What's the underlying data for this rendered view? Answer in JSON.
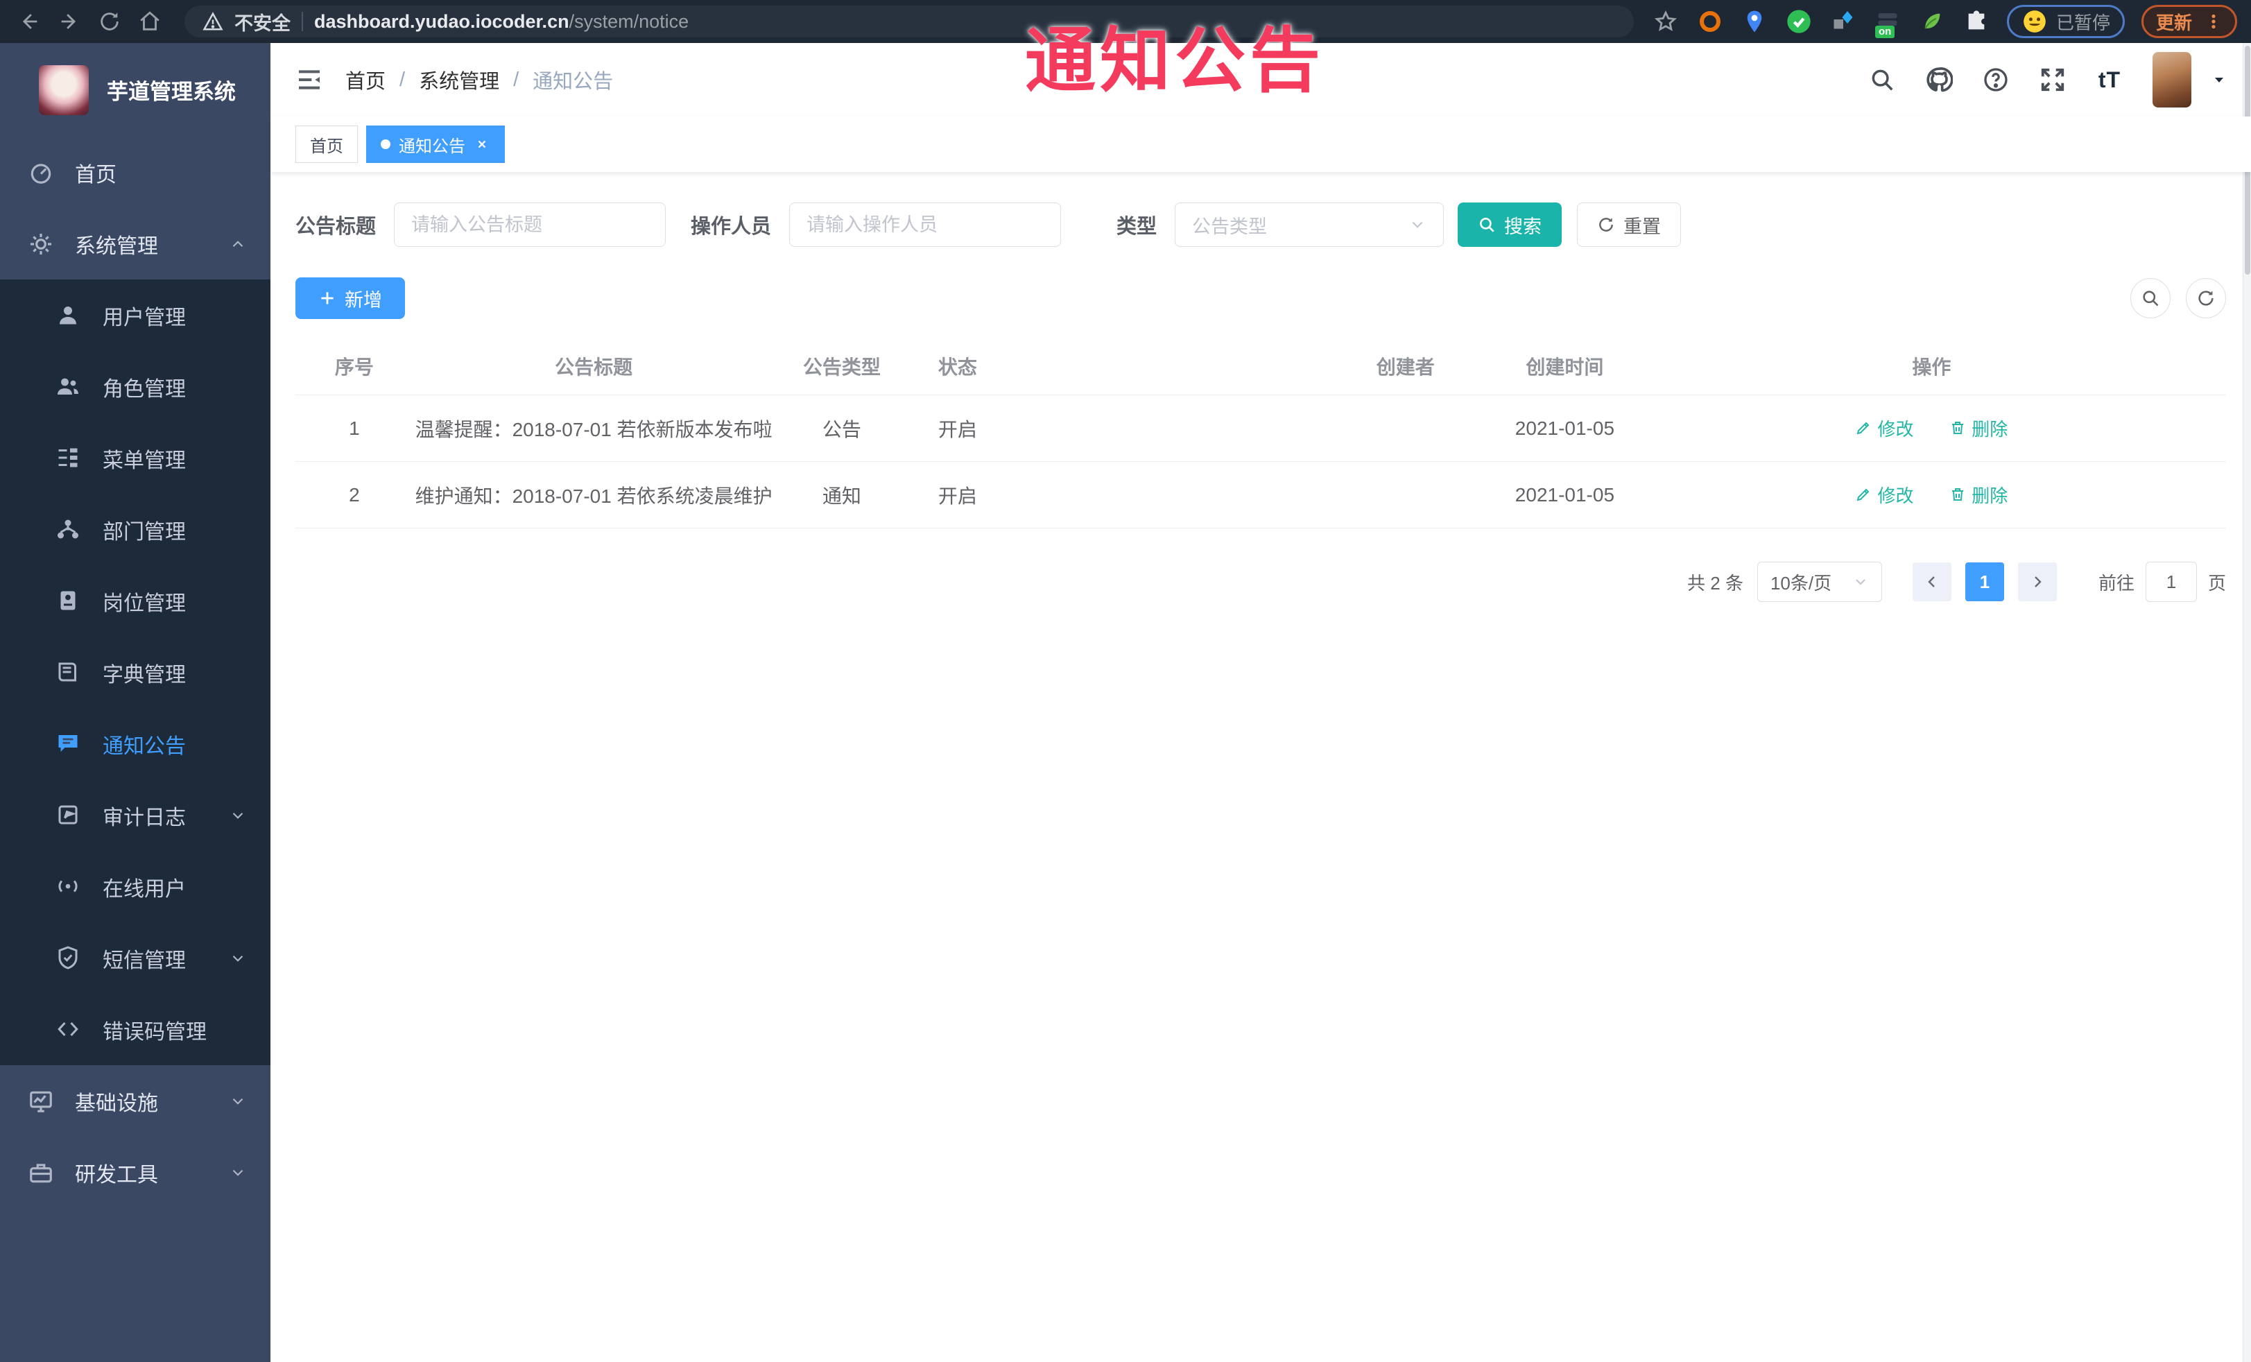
{
  "browser": {
    "security_label": "不安全",
    "url_host": "dashboard.yudao.iocoder.cn",
    "url_path": "/system/notice",
    "ext_badge": "on",
    "paused_label": "已暂停",
    "update_label": "更新"
  },
  "annotation": {
    "text": "通知公告",
    "color": "#F43B5E"
  },
  "sidebar": {
    "title": "芋道管理系统",
    "items": [
      {
        "label": "首页"
      },
      {
        "label": "系统管理"
      },
      {
        "label": "用户管理"
      },
      {
        "label": "角色管理"
      },
      {
        "label": "菜单管理"
      },
      {
        "label": "部门管理"
      },
      {
        "label": "岗位管理"
      },
      {
        "label": "字典管理"
      },
      {
        "label": "通知公告"
      },
      {
        "label": "审计日志"
      },
      {
        "label": "在线用户"
      },
      {
        "label": "短信管理"
      },
      {
        "label": "错误码管理"
      },
      {
        "label": "基础设施"
      },
      {
        "label": "研发工具"
      }
    ]
  },
  "header": {
    "breadcrumb": [
      "首页",
      "系统管理",
      "通知公告"
    ],
    "breadcrumb_sep": "/",
    "font_icon_label": "tT"
  },
  "tabs": [
    {
      "label": "首页"
    },
    {
      "label": "通知公告"
    }
  ],
  "filters": {
    "title_label": "公告标题",
    "title_placeholder": "请输入公告标题",
    "operator_label": "操作人员",
    "operator_placeholder": "请输入操作人员",
    "type_label": "类型",
    "type_placeholder": "公告类型",
    "search_label": "搜索",
    "reset_label": "重置"
  },
  "toolbar": {
    "add_label": "新增"
  },
  "table": {
    "headers": {
      "no": "序号",
      "title": "公告标题",
      "type": "公告类型",
      "status": "状态",
      "creator": "创建者",
      "created": "创建时间",
      "actions": "操作"
    },
    "rows": [
      {
        "no": "1",
        "title": "温馨提醒：2018-07-01 若依新版本发布啦",
        "type": "公告",
        "status": "开启",
        "creator": "",
        "created": "2021-01-05"
      },
      {
        "no": "2",
        "title": "维护通知：2018-07-01 若依系统凌晨维护",
        "type": "通知",
        "status": "开启",
        "creator": "",
        "created": "2021-01-05"
      }
    ],
    "edit_label": "修改",
    "delete_label": "删除"
  },
  "pagination": {
    "total": "共 2 条",
    "page_size": "10条/页",
    "current": "1",
    "goto_label": "前往",
    "goto_value": "1",
    "page_unit": "页"
  }
}
